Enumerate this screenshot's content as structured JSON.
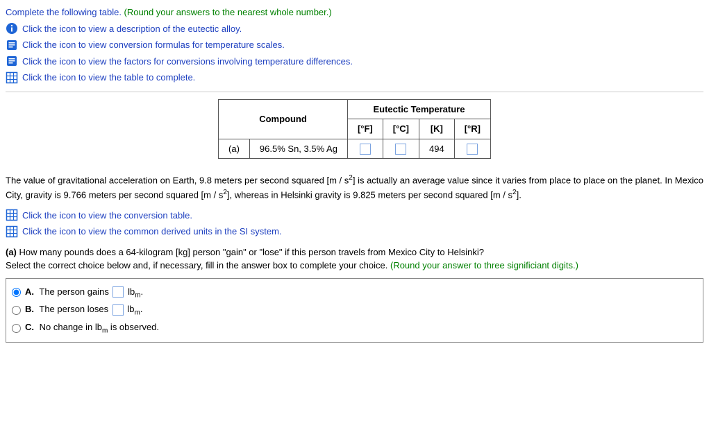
{
  "q1": {
    "prompt_pre": "Complete the following table.",
    "prompt_paren": " (Round your answers to the nearest whole number.)",
    "links": [
      "Click the icon to view a description of the eutectic alloy.",
      "Click the icon to view conversion formulas for temperature scales.",
      "Click the icon to view the factors for conversions involving temperature differences.",
      "Click the icon to view the table to complete."
    ]
  },
  "table": {
    "header_compound": "Compound",
    "header_group": "Eutectic Temperature",
    "col_f": "[°F]",
    "col_c": "[°C]",
    "col_k": "[K]",
    "col_r": "[°R]",
    "row_label": "(a)",
    "compound": "96.5% Sn, 3.5% Ag",
    "k_value": "494"
  },
  "q2": {
    "text_1": "The value of gravitational acceleration on Earth, 9.8 meters per second squared [m / s",
    "sq": "2",
    "text_2": "] is actually an average value since it varies from place to place on the planet. In Mexico City, gravity is 9.766 meters per second squared [m / s",
    "text_3": "], whereas in Helsinki gravity is 9.825 meters per second squared [m / s",
    "text_4": "].",
    "links": [
      "Click the icon to view the conversion table.",
      "Click the icon to view the common derived units in the SI system."
    ],
    "part_a_pre": "(a)",
    "part_a": " How many pounds does a 64-kilogram [kg] person \"gain\" or \"lose\" if this person travels from Mexico City to Helsinki?",
    "select_pre": "Select the correct choice below and, if necessary, fill in the answer box to complete your choice.",
    "select_paren": " (Round your answer to  three significiant digits.)"
  },
  "choices": {
    "a": {
      "letter": "A.",
      "pre": "The person gains ",
      "unit_pre": " lb",
      "unit_sub": "m",
      "post": "."
    },
    "b": {
      "letter": "B.",
      "pre": "The person loses ",
      "unit_pre": " lb",
      "unit_sub": "m",
      "post": "."
    },
    "c": {
      "letter": "C.",
      "pre": "No change in lb",
      "sub": "m",
      "post": " is observed."
    }
  }
}
